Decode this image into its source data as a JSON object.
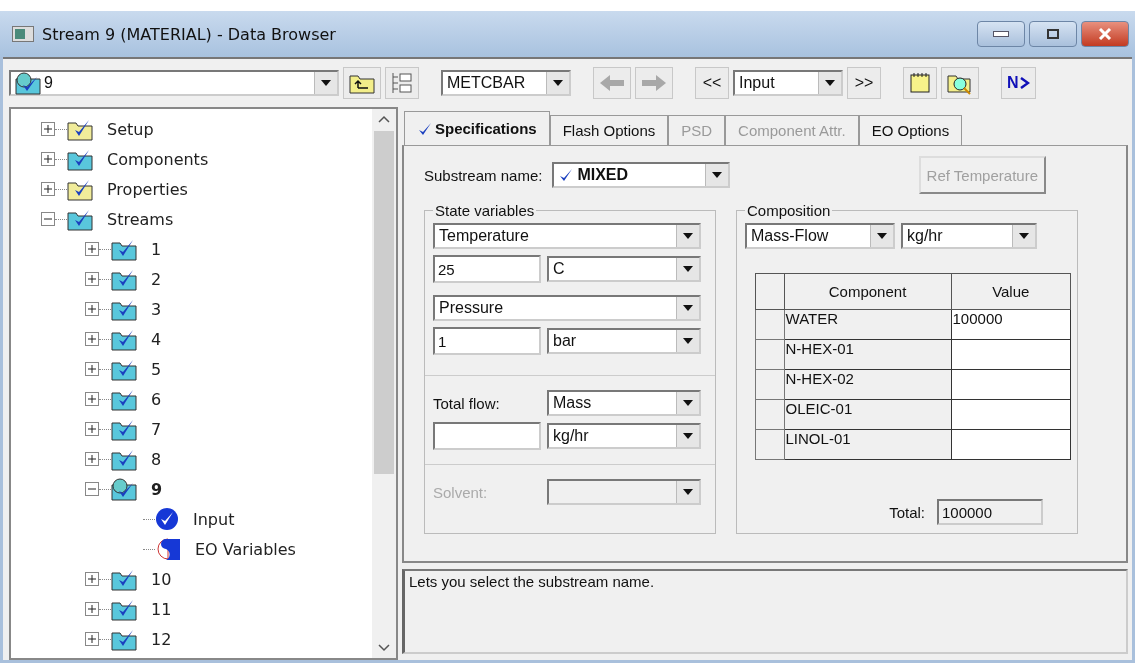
{
  "window": {
    "title": "Stream 9 (MATERIAL) - Data Browser"
  },
  "toolbar": {
    "object": "9",
    "unit_set": "METCBAR",
    "back": {
      "disabled": true
    },
    "forward": {
      "disabled": true
    },
    "previous_form": "<<",
    "form": "Input",
    "next_form": ">>",
    "next": "N"
  },
  "tree": [
    {
      "label": "Setup",
      "kind": "form",
      "expanded": false,
      "selected": false
    },
    {
      "label": "Components",
      "kind": "data",
      "expanded": false,
      "selected": false
    },
    {
      "label": "Properties",
      "kind": "form",
      "expanded": false,
      "selected": false
    },
    {
      "label": "Streams",
      "kind": "data",
      "expanded": true,
      "selected": false,
      "children": [
        {
          "label": "1",
          "kind": "data",
          "expanded": false,
          "selected": false
        },
        {
          "label": "2",
          "kind": "data",
          "expanded": false,
          "selected": false
        },
        {
          "label": "3",
          "kind": "data",
          "expanded": false,
          "selected": false
        },
        {
          "label": "4",
          "kind": "data",
          "expanded": false,
          "selected": false
        },
        {
          "label": "5",
          "kind": "data",
          "expanded": false,
          "selected": false
        },
        {
          "label": "6",
          "kind": "data",
          "expanded": false,
          "selected": false
        },
        {
          "label": "7",
          "kind": "data",
          "expanded": false,
          "selected": false
        },
        {
          "label": "8",
          "kind": "data",
          "expanded": false,
          "selected": false
        },
        {
          "label": "9",
          "kind": "stream",
          "expanded": true,
          "selected": true,
          "children": [
            {
              "label": "Input",
              "kind": "input",
              "selected": false
            },
            {
              "label": "EO Variables",
              "kind": "eo",
              "selected": false
            }
          ]
        },
        {
          "label": "10",
          "kind": "data",
          "expanded": false,
          "selected": false
        },
        {
          "label": "11",
          "kind": "data",
          "expanded": false,
          "selected": false
        },
        {
          "label": "12",
          "kind": "data",
          "expanded": false,
          "selected": false
        }
      ]
    }
  ],
  "tabs": [
    {
      "label": "Specifications",
      "selected": true,
      "complete": true,
      "disabled": false
    },
    {
      "label": "Flash Options",
      "selected": false,
      "complete": false,
      "disabled": false
    },
    {
      "label": "PSD",
      "selected": false,
      "complete": false,
      "disabled": true
    },
    {
      "label": "Component Attr.",
      "selected": false,
      "complete": false,
      "disabled": true
    },
    {
      "label": "EO Options",
      "selected": false,
      "complete": false,
      "disabled": false
    }
  ],
  "form": {
    "substream": {
      "label": "Substream name:",
      "value": "MIXED",
      "complete": true
    },
    "ref_button": {
      "label": "Ref Temperature",
      "disabled": true
    },
    "state_variables": {
      "title": "State variables",
      "specs": [
        {
          "variable": "Temperature",
          "value": "25",
          "unit": "C"
        },
        {
          "variable": "Pressure",
          "value": "1",
          "unit": "bar"
        }
      ],
      "total_flow": {
        "label": "Total flow:",
        "basis": "Mass",
        "unit": "kg/hr"
      },
      "solvent": {
        "label": "Solvent:",
        "disabled": true
      }
    },
    "composition": {
      "title": "Composition",
      "basis": "Mass-Flow",
      "unit": "kg/hr",
      "columns": [
        "Component",
        "Value"
      ],
      "rows": [
        {
          "component": "WATER",
          "value": "100000"
        },
        {
          "component": "N-HEX-01"
        },
        {
          "component": "N-HEX-02"
        },
        {
          "component": "OLEIC-01"
        },
        {
          "component": "LINOL-01"
        }
      ],
      "total_label": "Total:",
      "total": "100000"
    }
  },
  "status": "Lets you select the substream name."
}
